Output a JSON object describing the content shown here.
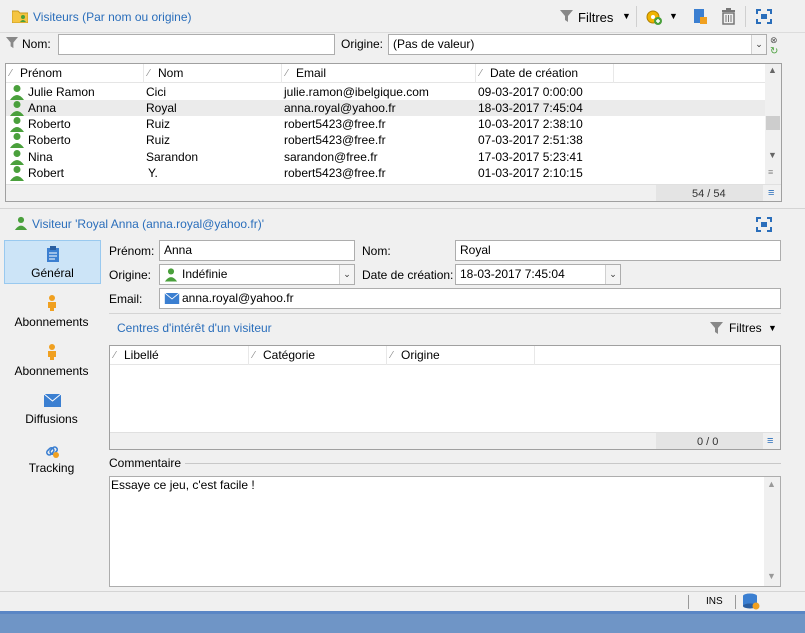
{
  "top": {
    "title": "Visiteurs (Par nom ou origine)",
    "filters_label": "Filtres"
  },
  "search": {
    "name_label": "Nom:",
    "name_value": "",
    "origin_label": "Origine:",
    "origin_value": "(Pas de valeur)"
  },
  "list": {
    "columns": [
      "Prénom",
      "Nom",
      "Email",
      "Date de création"
    ],
    "rows": [
      {
        "prenom": "Julie Ramon",
        "nom": "Cici",
        "email": "julie.ramon@ibelgique.com",
        "date": "09-03-2017 0:00:00"
      },
      {
        "prenom": "Anna",
        "nom": "Royal",
        "email": "anna.royal@yahoo.fr",
        "date": "18-03-2017 7:45:04"
      },
      {
        "prenom": "Roberto",
        "nom": "Ruiz",
        "email": "robert5423@free.fr",
        "date": "10-03-2017 2:38:10"
      },
      {
        "prenom": "Roberto",
        "nom": "Ruiz",
        "email": "robert5423@free.fr",
        "date": "07-03-2017 2:51:38"
      },
      {
        "prenom": "Nina",
        "nom": "Sarandon",
        "email": "sarandon@free.fr",
        "date": "17-03-2017 5:23:41"
      },
      {
        "prenom": "Robert",
        "nom": "Y.",
        "email": "robert5423@free.fr",
        "date": "01-03-2017 2:10:15"
      }
    ],
    "count": "54 / 54"
  },
  "detail": {
    "title": "Visiteur 'Royal Anna (anna.royal@yahoo.fr)'",
    "tabs": [
      "Général",
      "Abonnements",
      "Abonnements",
      "Diffusions",
      "Tracking"
    ],
    "prenom_label": "Prénom:",
    "prenom_value": "Anna",
    "nom_label": "Nom:",
    "nom_value": "Royal",
    "origine_label": "Origine:",
    "origine_value": "Indéfinie",
    "date_label": "Date de création:",
    "date_value": "18-03-2017 7:45:04",
    "email_label": "Email:",
    "email_value": "anna.royal@yahoo.fr",
    "interests_title": "Centres d'intérêt d'un visiteur",
    "interests_filters": "Filtres",
    "interests_columns": [
      "Libellé",
      "Catégorie",
      "Origine"
    ],
    "interests_count": "0 / 0",
    "comment_label": "Commentaire",
    "comment_value": "Essaye ce jeu, c'est facile !"
  },
  "status": {
    "ins": "INS"
  },
  "colors": {
    "accent": "#2a6ebb",
    "person_green": "#4aa03c",
    "selected_row": "#ebebeb",
    "active_tab": "#cce4f7"
  }
}
